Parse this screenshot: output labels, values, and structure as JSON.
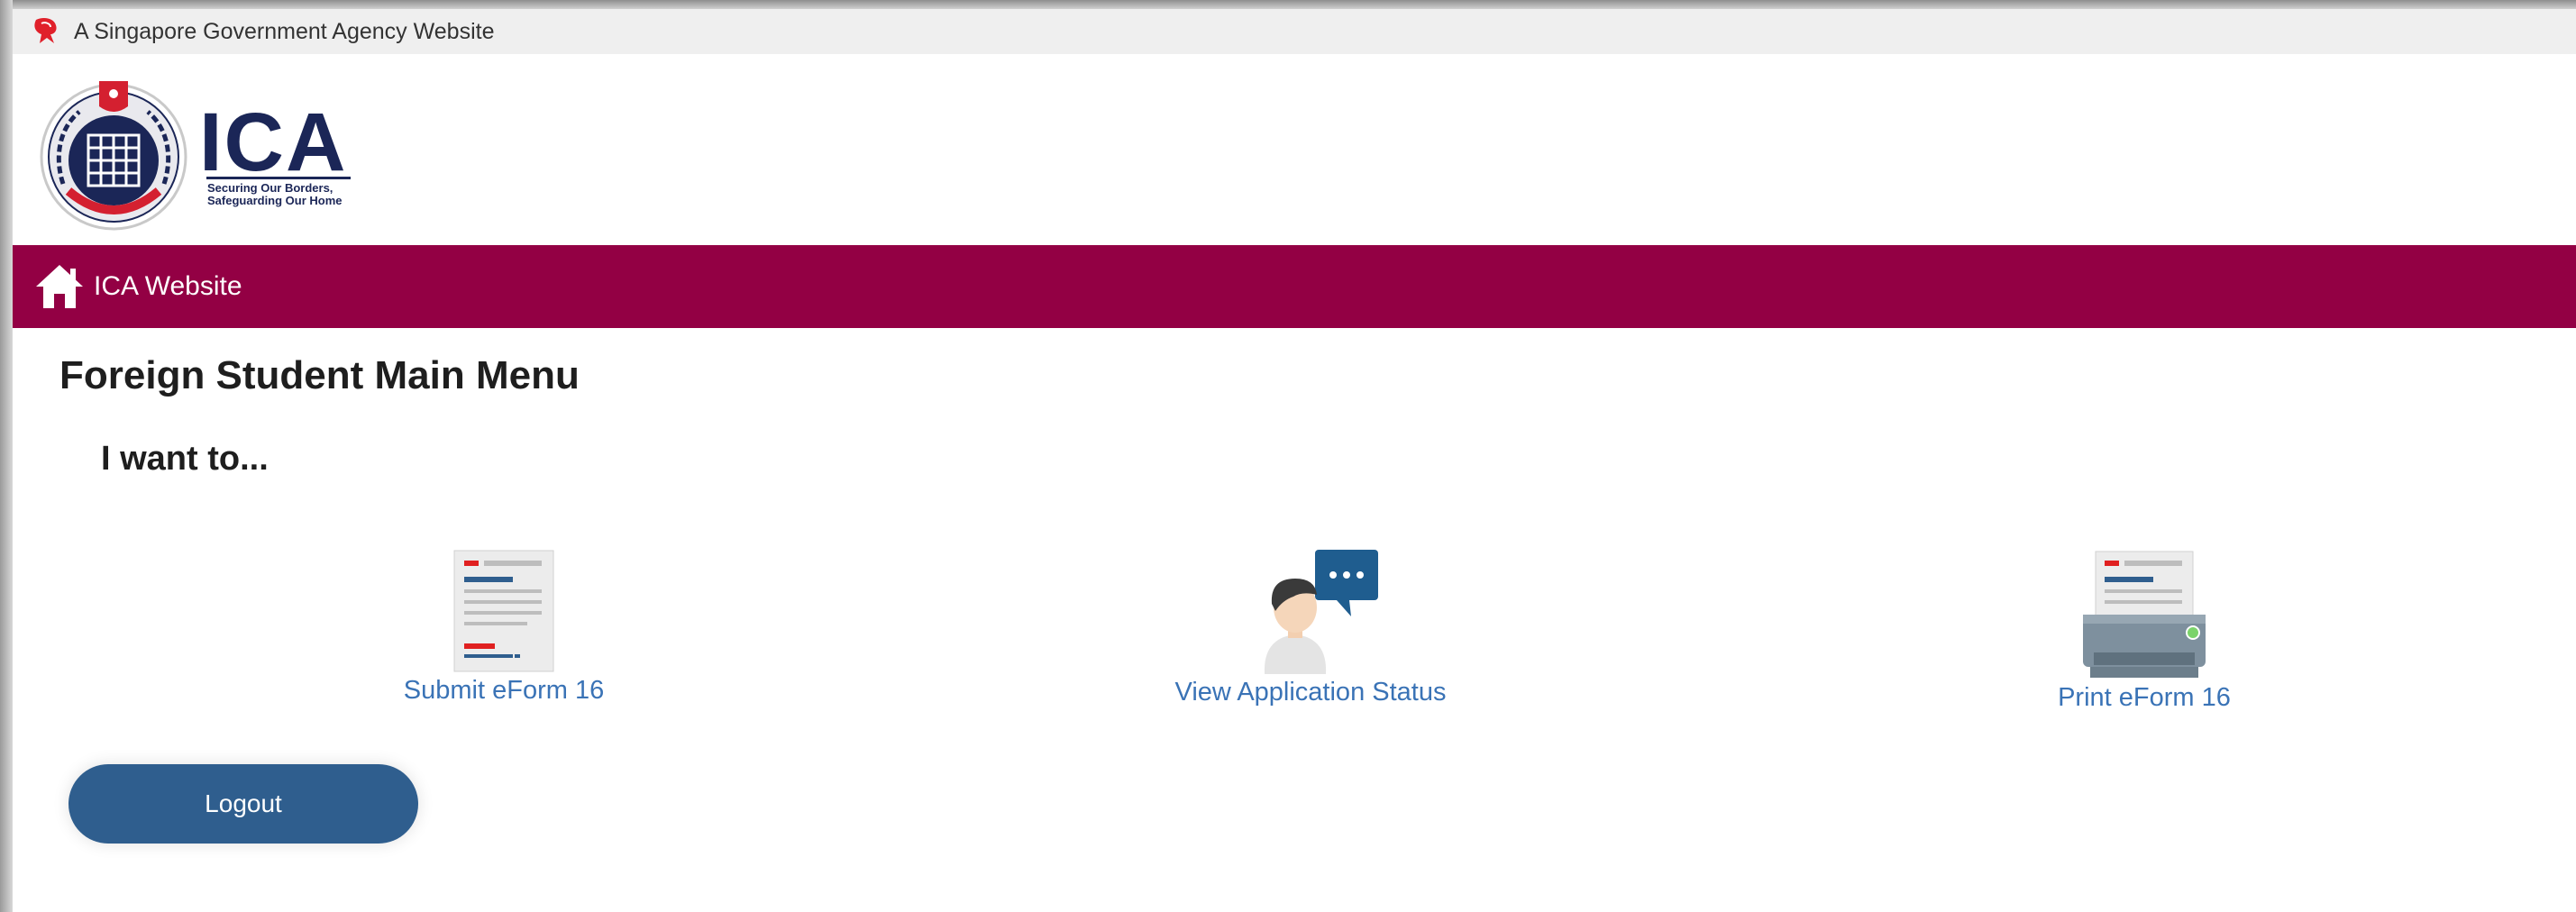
{
  "masthead": {
    "text": "A Singapore Government Agency Website",
    "icon": "singapore-lion-icon"
  },
  "logo": {
    "wordmark": "ICA",
    "tagline_line1": "Securing Our Borders,",
    "tagline_line2": "Safeguarding Our Home"
  },
  "nav": {
    "home_icon": "home-icon",
    "home_label": "ICA Website",
    "bar_color": "#930044"
  },
  "main": {
    "title": "Foreign Student Main Menu",
    "subtitle": "I want to...",
    "options": [
      {
        "label": "Submit eForm 16",
        "icon": "document-icon"
      },
      {
        "label": "View Application Status",
        "icon": "person-chat-icon"
      },
      {
        "label": "Print eForm 16",
        "icon": "printer-icon"
      }
    ],
    "logout_label": "Logout"
  },
  "colors": {
    "link": "#3a73b6",
    "button": "#2f5e8e",
    "brand_navy": "#1b2657"
  }
}
